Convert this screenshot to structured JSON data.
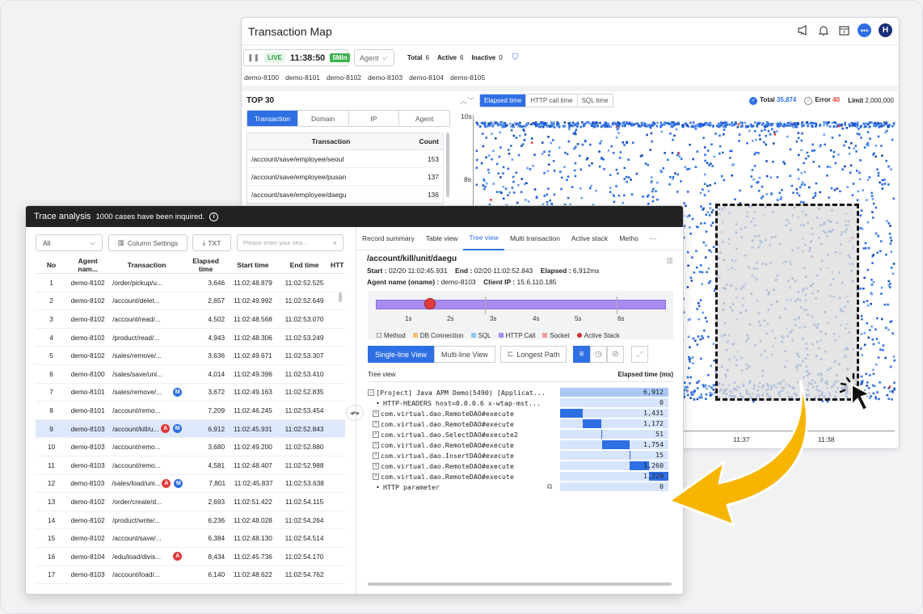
{
  "back": {
    "title": "Transaction Map",
    "live": {
      "label": "LIVE",
      "time": "11:38:50",
      "range": "5Min"
    },
    "agent_dropdown": "Agent",
    "total_label": "Total",
    "total_value": "6",
    "active_label": "Active",
    "active_value": "6",
    "inactive_label": "Inactive",
    "inactive_value": "0",
    "demos": [
      "demo-8100",
      "demo-8101",
      "demo-8102",
      "demo-8103",
      "demo-8104",
      "demo-8105"
    ],
    "top30": "TOP 30",
    "top_tabs": [
      "Transaction",
      "Domain",
      "IP",
      "Agent"
    ],
    "top_table": {
      "headers": [
        "Transaction",
        "Count"
      ],
      "rows": [
        [
          "/account/save/employee/seoul",
          "153"
        ],
        [
          "/account/save/employee/pusan",
          "137"
        ],
        [
          "/account/save/employee/daegu",
          "136"
        ]
      ]
    },
    "chart_tabs": [
      "Elapsed time",
      "HTTP call time",
      "SQL time"
    ],
    "stats": {
      "total_label": "Total",
      "total_value": "35,874",
      "error_label": "Error",
      "error_value": "40",
      "limit_label": "Limit",
      "limit_value": "2,000,000"
    },
    "y_labels": [
      "10s",
      "8s"
    ],
    "x_labels": [
      "11:37",
      "11:38"
    ],
    "icons": [
      "megaphone-icon",
      "bell-icon",
      "calendar-icon",
      "chat-icon"
    ],
    "avatar": "H"
  },
  "front": {
    "title": "Trace analysis",
    "subtitle": "1000 cases have been inquired.",
    "filter_value": "All",
    "column_settings": "Column Settings",
    "txt": "TXT",
    "search_placeholder": "Please enter your sea...",
    "headers": [
      "No",
      "Agent nam...",
      "Transaction",
      "Elapsed time",
      "Start time",
      "End time",
      "HTT"
    ],
    "rows": [
      {
        "no": "1",
        "agent": "demo-8102",
        "tx": "/order/pickup/u...",
        "el": "3,646",
        "st": "11:02:48.879",
        "et": "11:02:52.525",
        "b": []
      },
      {
        "no": "2",
        "agent": "demo-8102",
        "tx": "/account/delet...",
        "el": "2,657",
        "st": "11:02:49.992",
        "et": "11:02:52.649",
        "b": []
      },
      {
        "no": "3",
        "agent": "demo-8102",
        "tx": "/account/read/...",
        "el": "4,502",
        "st": "11:02:48.568",
        "et": "11:02:53.070",
        "b": []
      },
      {
        "no": "4",
        "agent": "demo-8102",
        "tx": "/product/read/...",
        "el": "4,943",
        "st": "11:02:48.306",
        "et": "11:02:53.249",
        "b": []
      },
      {
        "no": "5",
        "agent": "demo-8102",
        "tx": "/sales/remove/...",
        "el": "3,636",
        "st": "11:02:49.671",
        "et": "11:02:53.307",
        "b": []
      },
      {
        "no": "6",
        "agent": "demo-8100",
        "tx": "/sales/save/uni...",
        "el": "4,014",
        "st": "11:02:49.396",
        "et": "11:02:53.410",
        "b": []
      },
      {
        "no": "7",
        "agent": "demo-8101",
        "tx": "/sales/remove/...",
        "el": "3,672",
        "st": "11:02:49.163",
        "et": "11:02:52.835",
        "b": [
          "M"
        ]
      },
      {
        "no": "8",
        "agent": "demo-8101",
        "tx": "/account/remo...",
        "el": "7,209",
        "st": "11:02:46.245",
        "et": "11:02:53.454",
        "b": []
      },
      {
        "no": "9",
        "agent": "demo-8103",
        "tx": "/account/kill/u...",
        "el": "6,912",
        "st": "11:02:45.931",
        "et": "11:02:52.843",
        "b": [
          "A",
          "M"
        ],
        "sel": true
      },
      {
        "no": "10",
        "agent": "demo-8103",
        "tx": "/account/remo...",
        "el": "3,680",
        "st": "11:02:49.200",
        "et": "11:02:52.880",
        "b": []
      },
      {
        "no": "11",
        "agent": "demo-8103",
        "tx": "/account/remo...",
        "el": "4,581",
        "st": "11:02:48.407",
        "et": "11:02:52.988",
        "b": []
      },
      {
        "no": "12",
        "agent": "demo-8103",
        "tx": "/sales/load/uni...",
        "el": "7,801",
        "st": "11:02:45.837",
        "et": "11:02:53.638",
        "b": [
          "A",
          "M"
        ]
      },
      {
        "no": "13",
        "agent": "demo-8102",
        "tx": "/order/create/d...",
        "el": "2,693",
        "st": "11:02:51.422",
        "et": "11:02:54.115",
        "b": []
      },
      {
        "no": "14",
        "agent": "demo-8102",
        "tx": "/product/write/...",
        "el": "6,236",
        "st": "11:02:48.028",
        "et": "11:02:54.264",
        "b": []
      },
      {
        "no": "15",
        "agent": "demo-8102",
        "tx": "/account/save/...",
        "el": "6,384",
        "st": "11:02:48.130",
        "et": "11:02:54.514",
        "b": []
      },
      {
        "no": "16",
        "agent": "demo-8104",
        "tx": "/edu/load/divis...",
        "el": "8,434",
        "st": "11:02:45.736",
        "et": "11:02:54.170",
        "b": [
          "A"
        ]
      },
      {
        "no": "17",
        "agent": "demo-8103",
        "tx": "/account/load/...",
        "el": "6,140",
        "st": "11:02:48.622",
        "et": "11:02:54.762",
        "b": []
      }
    ],
    "rtabs": [
      "Record summary",
      "Table view",
      "Tree view",
      "Multi transaction",
      "Active stack",
      "Metho",
      "···"
    ],
    "path": "/account/kill/unit/daegu",
    "start_label": "Start :",
    "start": "02/20 11:02:45.931",
    "end_label": "End :",
    "end": "02/20 11:02:52.843",
    "elapsed_label": "Elapsed :",
    "elapsed": "6,912ms",
    "agent_label": "Agent name (oname) :",
    "agent": "demo-8103",
    "ip_label": "Client IP :",
    "ip": "15.6.110.185",
    "tl_labels": [
      "1s",
      "2s",
      "3s",
      "4s",
      "5s",
      "6s"
    ],
    "legend": [
      "Method",
      "DB Connection",
      "SQL",
      "HTTP Call",
      "Socket",
      "Active Stack"
    ],
    "views": [
      "Single-line View",
      "Multi-line View",
      "Longest Path"
    ],
    "tree_header": "Tree view",
    "tree_elapsed": "Elapsed time (ms)",
    "tree": [
      {
        "t": "[Project] Java APM Demo(5490) [Applicat...",
        "v": "6,912",
        "f": 1.0,
        "s": 0,
        "box": "−"
      },
      {
        "t": "HTTP-HEADERS host=0.0.0.6 x-wtap-mst...",
        "v": "0",
        "f": 0,
        "s": 0,
        "box": "•"
      },
      {
        "t": "com.virtual.dao.RemoteDAO#execute",
        "v": "1,431",
        "f": 0.21,
        "s": 0,
        "box": "+"
      },
      {
        "t": "com.virtual.dao.RemoteDAO#execute",
        "v": "1,172",
        "f": 0.17,
        "s": 0.21,
        "box": "+"
      },
      {
        "t": "com.virtual.dao.SelectDAO#execute2",
        "v": "51",
        "f": 0.01,
        "s": 0.38,
        "box": "+"
      },
      {
        "t": "com.virtual.dao.RemoteDAO#execute",
        "v": "1,754",
        "f": 0.25,
        "s": 0.39,
        "box": "+"
      },
      {
        "t": "com.virtual.dao.InsertDAO#execute",
        "v": "15",
        "f": 0.005,
        "s": 0.64,
        "box": "+"
      },
      {
        "t": "com.virtual.dao.RemoteDAO#execute",
        "v": "1,260",
        "f": 0.18,
        "s": 0.64,
        "box": "+"
      },
      {
        "t": "com.virtual.dao.RemoteDAO#execute",
        "v": "1,229",
        "f": 0.18,
        "s": 0.82,
        "box": "+"
      },
      {
        "t": "HTTP parameter",
        "v": "0",
        "f": 0,
        "s": 0,
        "box": "•"
      }
    ]
  }
}
